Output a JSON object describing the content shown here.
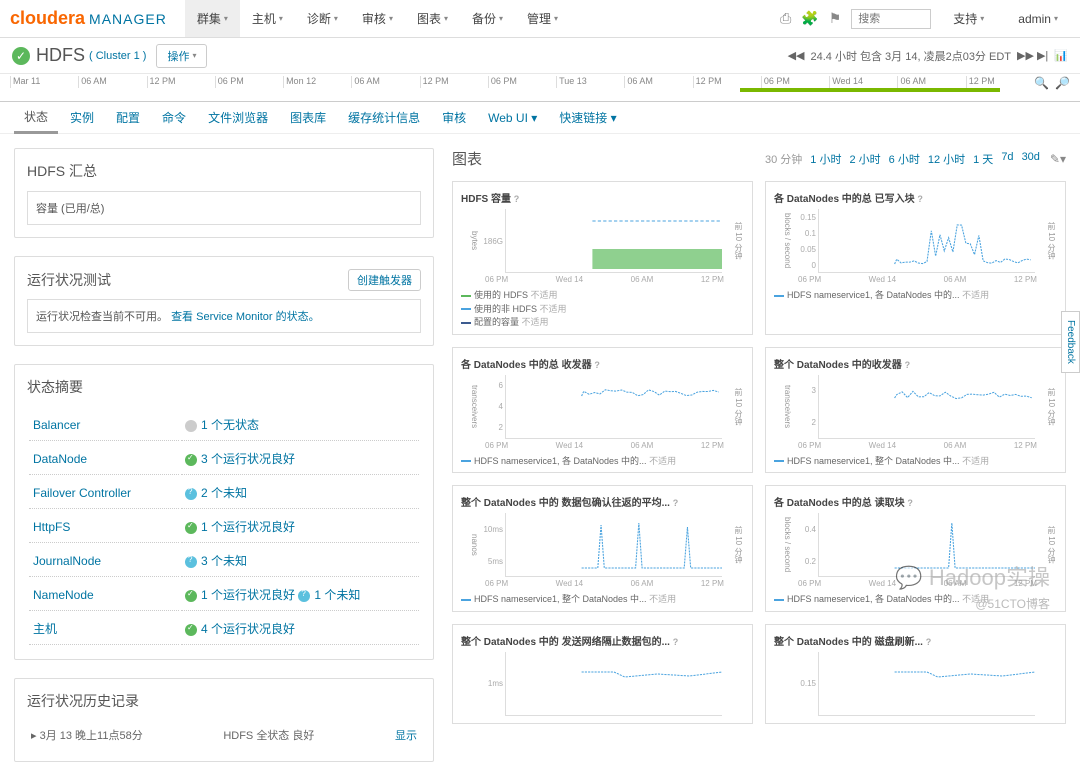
{
  "brand": {
    "c": "cloudera",
    "m": "MANAGER"
  },
  "topnav": [
    {
      "label": "群集",
      "active": true
    },
    {
      "label": "主机"
    },
    {
      "label": "诊断"
    },
    {
      "label": "审核"
    },
    {
      "label": "图表"
    },
    {
      "label": "备份"
    },
    {
      "label": "管理"
    }
  ],
  "search_ph": "搜索",
  "support": "支持",
  "admin": "admin",
  "svc": {
    "name": "HDFS",
    "cluster": "( Cluster 1 )",
    "op": "操作"
  },
  "time": {
    "rewind": "◀◀",
    "span": "24.4 小时 包含 3月 14, 凌晨2点03分 EDT",
    "fwd": "▶▶ ▶|"
  },
  "timeline": [
    "Mar 11",
    "06 AM",
    "12 PM",
    "06 PM",
    "Mon 12",
    "06 AM",
    "12 PM",
    "06 PM",
    "Tue 13",
    "06 AM",
    "12 PM",
    "06 PM",
    "Wed 14",
    "06 AM",
    "12 PM"
  ],
  "subtabs": [
    "状态",
    "实例",
    "配置",
    "命令",
    "文件浏览器",
    "图表库",
    "缓存统计信息",
    "审核",
    "Web UI ▾",
    "快速链接 ▾"
  ],
  "left": {
    "summary_title": "HDFS 汇总",
    "capacity": "容量 (已用/总)",
    "health_title": "运行状况测试",
    "health_btn": "创建触发器",
    "health_msg_pre": "运行状况检查当前不可用。",
    "health_msg_link": "查看 Service Monitor 的状态。",
    "status_title": "状态摘要",
    "rows": [
      {
        "name": "Balancer",
        "badge": "none",
        "text": "1 个无状态"
      },
      {
        "name": "DataNode",
        "badge": "ok",
        "text": "3 个运行状况良好"
      },
      {
        "name": "Failover Controller",
        "badge": "unk",
        "text": "2 个未知"
      },
      {
        "name": "HttpFS",
        "badge": "ok",
        "text": "1 个运行状况良好"
      },
      {
        "name": "JournalNode",
        "badge": "unk",
        "text": "3 个未知"
      },
      {
        "name": "NameNode",
        "badge": "ok",
        "text": "1 个运行状况良好",
        "badge2": "unk",
        "text2": "1 个未知"
      },
      {
        "name": "主机",
        "badge": "ok",
        "text": "4 个运行状况良好"
      }
    ],
    "history_title": "运行状况历史记录",
    "history": {
      "time": "3月 13 晚上11点58分",
      "desc": "HDFS 全状态 良好",
      "link": "显示"
    }
  },
  "charts": {
    "title": "图表",
    "ranges": [
      "30 分钟",
      "1 小时",
      "2 小时",
      "6 小时",
      "12 小时",
      "1 天",
      "7d",
      "30d"
    ],
    "selected": "30 分钟",
    "xticks": [
      "06 PM",
      "Wed 14",
      "06 AM",
      "12 PM"
    ],
    "cards": [
      {
        "title": "HDFS 容量",
        "ylab": "bytes",
        "ytick": "186G",
        "rlab": "前 10 分钟",
        "legend": [
          {
            "c": "#5cb85c",
            "t": "使用的 HDFS 不适用"
          },
          {
            "c": "#4aa3df",
            "t": "使用的非 HDFS 不适用"
          },
          {
            "c": "#3c5b8f",
            "t": "配置的容量 不适用"
          }
        ],
        "series": {
          "fill": "#8fd08f",
          "y": 40,
          "line": "#4aa3df",
          "ly": 12
        }
      },
      {
        "title": "各 DataNodes 中的总 已写入块",
        "ylab": "blocks / second",
        "yticks": [
          "0.15",
          "0.1",
          "0.05",
          "0"
        ],
        "rlab": "前 10 分钟",
        "legend": [
          {
            "c": "#4aa3df",
            "t": "HDFS nameservice1, 各 DataNodes 中的... 不适用"
          }
        ],
        "spiky": true
      },
      {
        "title": "各 DataNodes 中的总 收发器",
        "ylab": "transceivers",
        "yticks": [
          "6",
          "4",
          "2"
        ],
        "rlab": "前 10 分钟",
        "legend": [
          {
            "c": "#4aa3df",
            "t": "HDFS nameservice1, 各 DataNodes 中的... 不适用"
          }
        ],
        "band": true,
        "bandY": 18
      },
      {
        "title": "整个 DataNodes 中的收发器",
        "ylab": "transceivers",
        "yticks": [
          "3",
          "2"
        ],
        "rlab": "前 10 分钟",
        "legend": [
          {
            "c": "#4aa3df",
            "t": "HDFS nameservice1, 整个 DataNodes 中... 不适用"
          }
        ],
        "band": true,
        "bandY": 20
      },
      {
        "title": "整个 DataNodes 中的 数据包确认往返的平均...",
        "ylab": "nanos",
        "yticks": [
          "10ms",
          "5ms"
        ],
        "rlab": "前 10 分钟",
        "legend": [
          {
            "c": "#4aa3df",
            "t": "HDFS nameservice1, 整个 DataNodes 中... 不适用"
          }
        ],
        "spikes3": true
      },
      {
        "title": "各 DataNodes 中的总 读取块",
        "ylab": "blocks / second",
        "yticks": [
          "0.4",
          "0.2"
        ],
        "rlab": "前 10 分钟",
        "legend": [
          {
            "c": "#4aa3df",
            "t": "HDFS nameservice1, 各 DataNodes 中的... 不适用"
          }
        ],
        "spike1": true
      },
      {
        "title": "整个 DataNodes 中的 发送网络隔止数据包的...",
        "ylab": "",
        "yticks": [
          "1ms"
        ],
        "rlab": "",
        "legend": [],
        "partial": true
      },
      {
        "title": "整个 DataNodes 中的 磁盘刷新...",
        "ylab": "",
        "yticks": [
          "0.15"
        ],
        "rlab": "",
        "legend": [],
        "partial": true
      }
    ]
  },
  "feedback": "Feedback",
  "wm1": "Hadoop实操",
  "wm2": "@51CTO博客"
}
